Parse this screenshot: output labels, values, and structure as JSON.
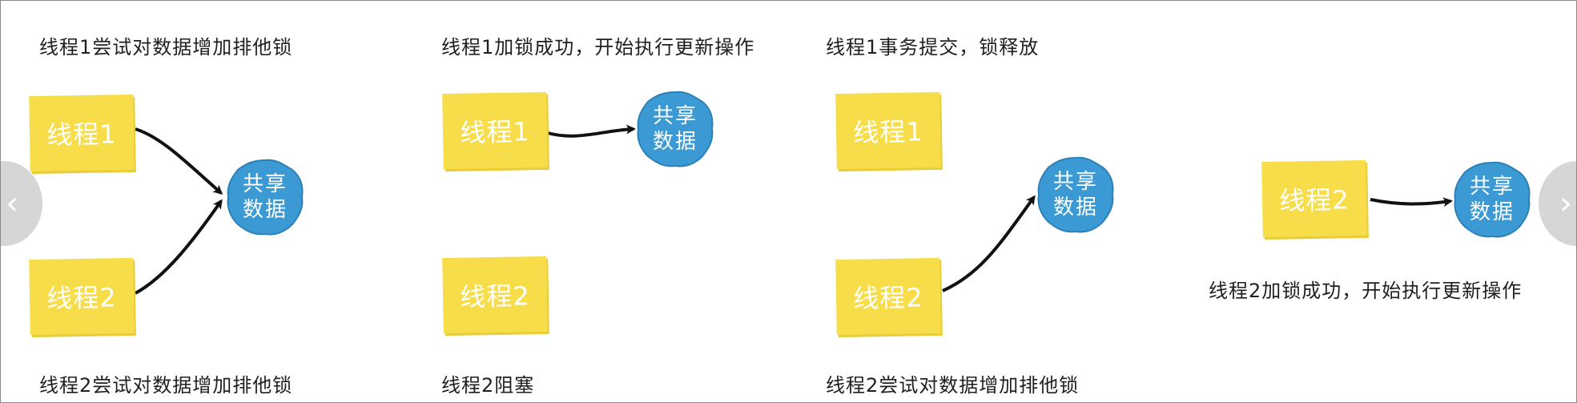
{
  "panels": [
    {
      "top_caption": "线程1尝试对数据增加排他锁",
      "bottom_caption": "线程2尝试对数据增加排他锁",
      "thread1": "线程1",
      "thread2": "线程2",
      "shared_data": [
        "共享",
        "数据"
      ]
    },
    {
      "top_caption": "线程1加锁成功，开始执行更新操作",
      "bottom_caption": "线程2阻塞",
      "thread1": "线程1",
      "thread2": "线程2",
      "shared_data": [
        "共享",
        "数据"
      ]
    },
    {
      "top_caption": "线程1事务提交，锁释放",
      "bottom_caption": "线程2尝试对数据增加排他锁",
      "thread1": "线程1",
      "thread2": "线程2",
      "shared_data": [
        "共享",
        "数据"
      ]
    },
    {
      "caption": "线程2加锁成功，开始执行更新操作",
      "thread2": "线程2",
      "shared_data": [
        "共享",
        "数据"
      ]
    }
  ],
  "colors": {
    "sticky_note": "#f8dd4a",
    "shared_data_blob": "#3b9ad4",
    "arrow": "#111111"
  },
  "icons": {
    "nav_prev": "‹",
    "nav_next": "›"
  }
}
